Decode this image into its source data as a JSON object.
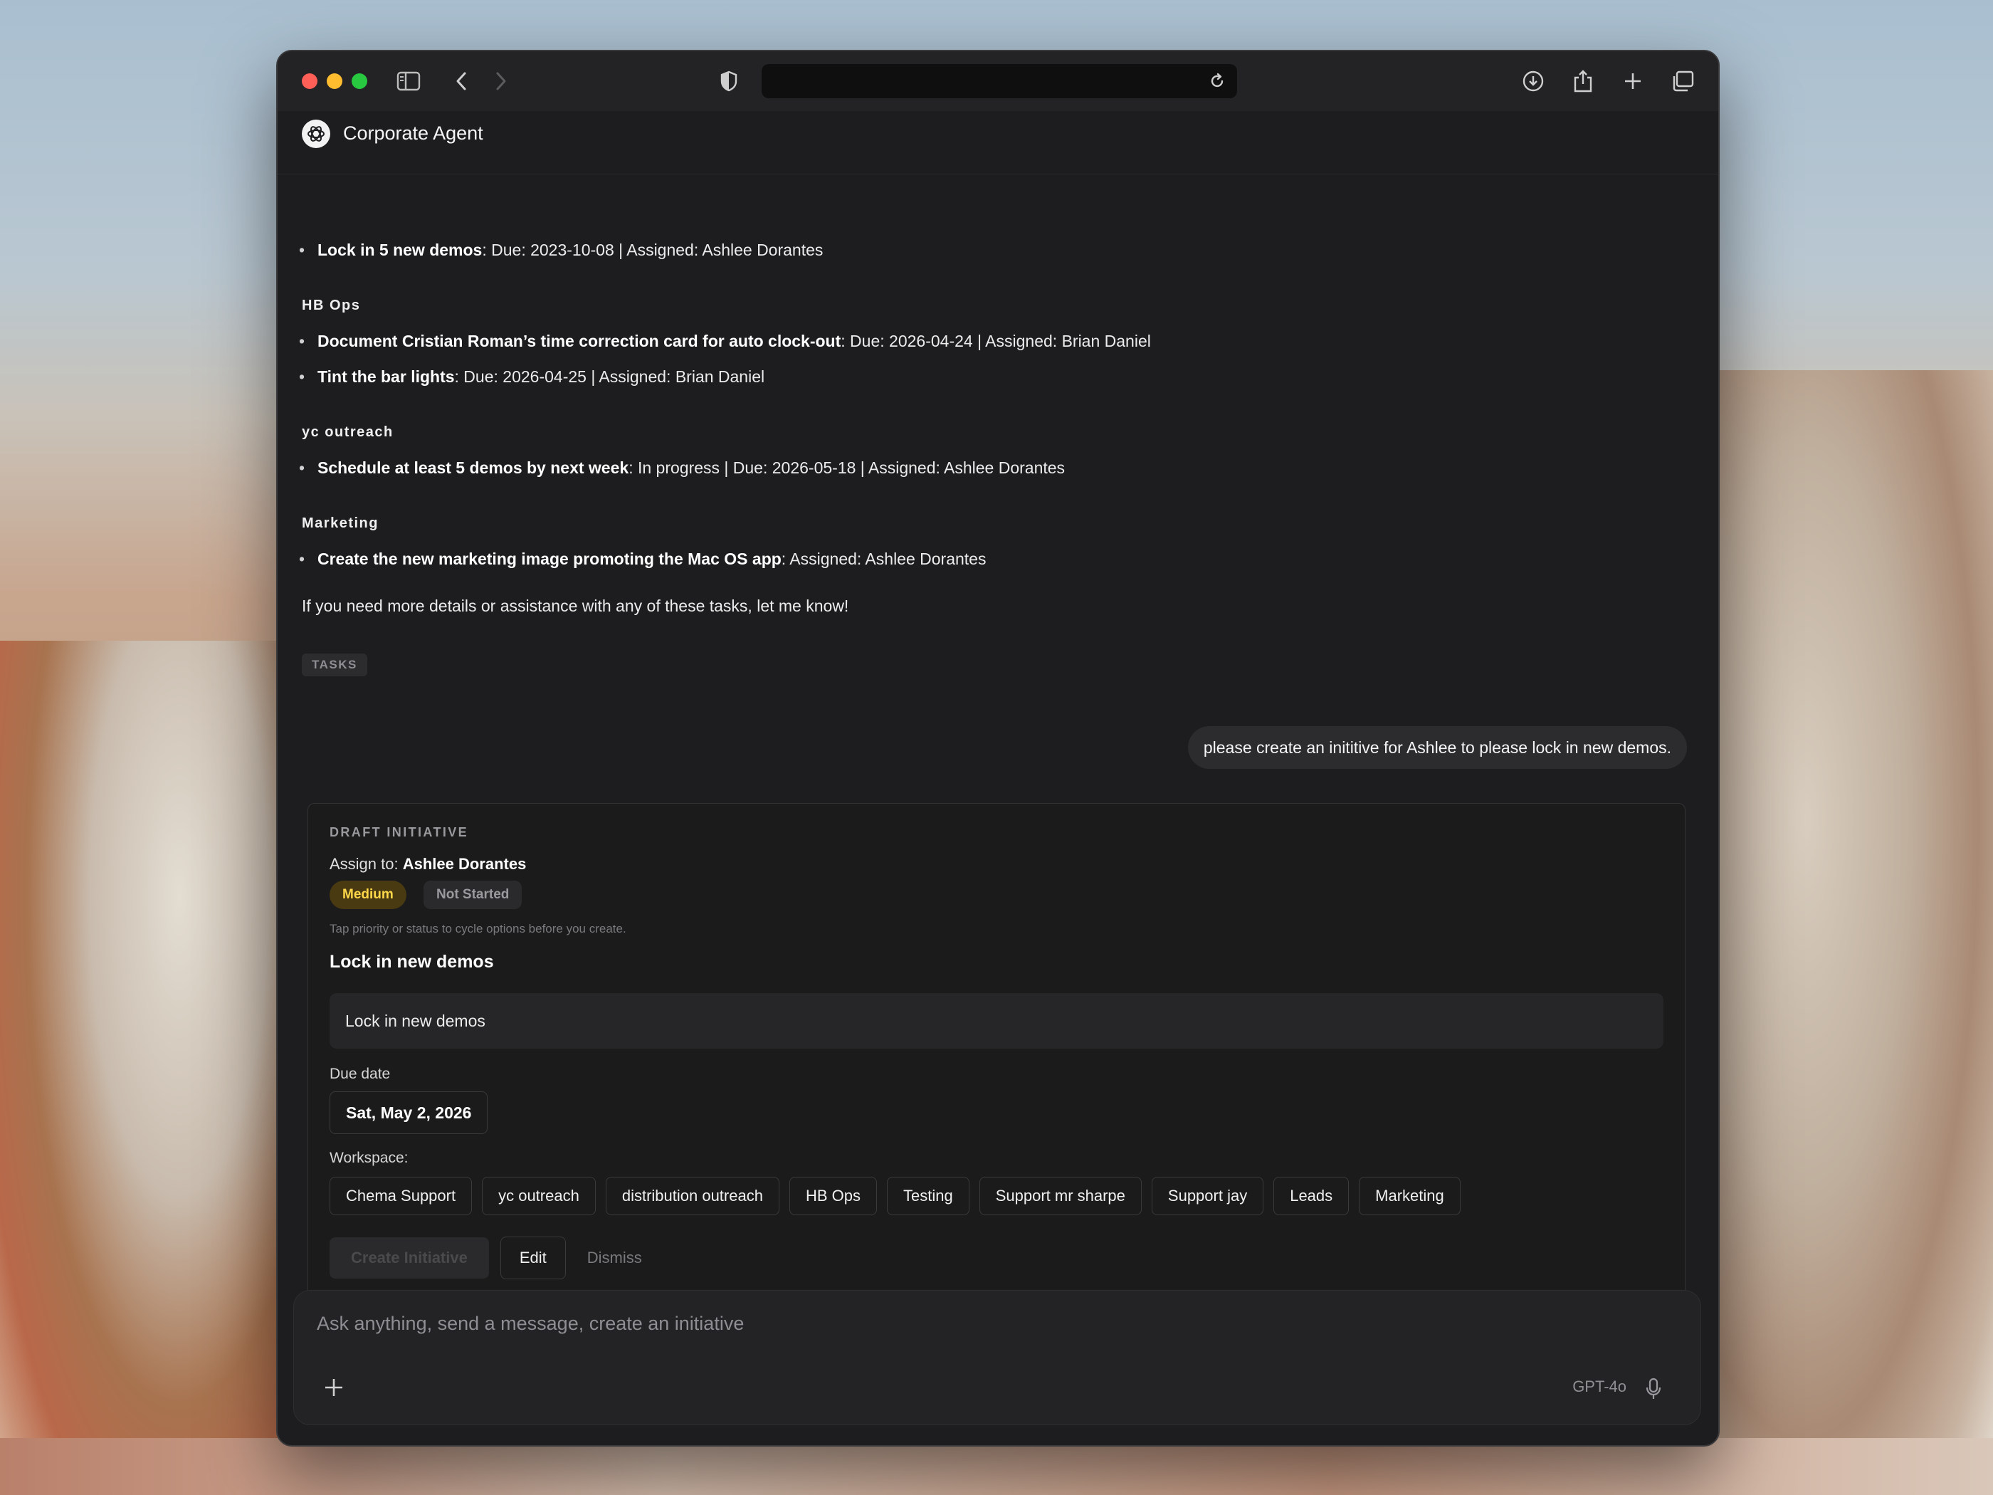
{
  "app": {
    "title": "Corporate Agent"
  },
  "browser": {
    "url": ""
  },
  "messages": {
    "task_groups": [
      {
        "id": "g0",
        "name": "",
        "tasks": [
          {
            "title": "Lock in 5 new demos",
            "details": ": Due: 2023-10-08 | Assigned: Ashlee Dorantes"
          }
        ]
      },
      {
        "id": "g1",
        "name": "HB Ops",
        "tasks": [
          {
            "title": "Document Cristian Roman’s time correction card for auto clock-out",
            "details": ": Due: 2026-04-24 | Assigned: Brian Daniel"
          },
          {
            "title": "Tint the bar lights",
            "details": ": Due: 2026-04-25 | Assigned: Brian Daniel"
          }
        ]
      },
      {
        "id": "g2",
        "name": "yc outreach",
        "tasks": [
          {
            "title": "Schedule at least 5 demos by next week",
            "details": ": In progress | Due: 2026-05-18 | Assigned: Ashlee Dorantes"
          }
        ]
      },
      {
        "id": "g3",
        "name": "Marketing",
        "tasks": [
          {
            "title": "Create the new marketing image promoting the Mac OS app",
            "details": ": Assigned: Ashlee Dorantes"
          }
        ]
      }
    ],
    "closing": "If you need more details or assistance with any of these tasks, let me know!",
    "tag": "TASKS",
    "user_message": "please create an inititive for Ashlee to please lock in new demos."
  },
  "draft": {
    "header": "DRAFT INITIATIVE",
    "assign_prefix": "Assign to: ",
    "assignee": "Ashlee Dorantes",
    "priority": "Medium",
    "status": "Not Started",
    "hint": "Tap priority or status to cycle options before you create.",
    "title": "Lock in new demos",
    "description": "Lock in new demos",
    "due_label": "Due date",
    "due_value": "Sat, May 2, 2026",
    "workspace_label": "Workspace:",
    "workspaces": [
      "Chema Support",
      "yc outreach",
      "distribution outreach",
      "HB Ops",
      "Testing",
      "Support mr sharpe",
      "Support jay",
      "Leads",
      "Marketing"
    ],
    "create_label": "Create Initiative",
    "edit_label": "Edit",
    "dismiss_label": "Dismiss"
  },
  "composer": {
    "placeholder": "Ask anything, send a message, create an initiative",
    "model": "GPT-4o"
  },
  "colors": {
    "priority_medium": "#ffd84a",
    "window_bg": "#1d1d1f"
  },
  "icons": [
    "sidebar-icon",
    "back-icon",
    "forward-icon",
    "shield-icon",
    "reload-icon",
    "download-icon",
    "share-icon",
    "new-tab-icon",
    "tabs-overview-icon",
    "openai-logo-icon",
    "plus-icon",
    "microphone-icon"
  ]
}
